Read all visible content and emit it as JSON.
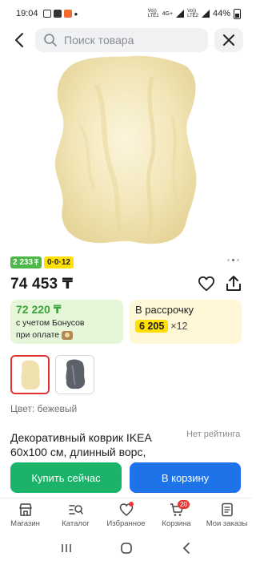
{
  "status_bar": {
    "time": "19:04",
    "network_1": "Vo))\nLTE1",
    "network_2": "Vo))\nLTE2",
    "network_gen": "4G+",
    "battery": "44%"
  },
  "search": {
    "placeholder": "Поиск товара"
  },
  "gallery": {
    "images_count": 3,
    "active_index": 1
  },
  "badges": {
    "bonus_value": "2 233",
    "installment_plan": "0·0·12"
  },
  "product": {
    "price": "74 453 ₸",
    "color_label": "Цвет: бежевый",
    "title": "Декоративный коврик IKEA 60x100 см, длинный ворс,",
    "rating_text": "Нет рейтинга"
  },
  "offers": {
    "bonus_price": "72 220 ₸",
    "bonus_note_line1": "с учетом Бонусов",
    "bonus_note_line2": "при оплате",
    "installment_title": "В рассрочку",
    "installment_amount": "6 205",
    "installment_months": "×12"
  },
  "actions": {
    "buy_now": "Купить сейчас",
    "add_to_cart": "В корзину"
  },
  "bottom_nav": {
    "items": [
      {
        "label": "Магазин"
      },
      {
        "label": "Каталог"
      },
      {
        "label": "Избранное"
      },
      {
        "label": "Корзина"
      },
      {
        "label": "Мои заказы"
      }
    ],
    "cart_count": "20"
  },
  "colors": {
    "green_button": "#1bb36a",
    "blue_button": "#1e73e8",
    "bonus_green": "#4db848",
    "yellow": "#ffe000",
    "red_badge": "#e53935"
  }
}
